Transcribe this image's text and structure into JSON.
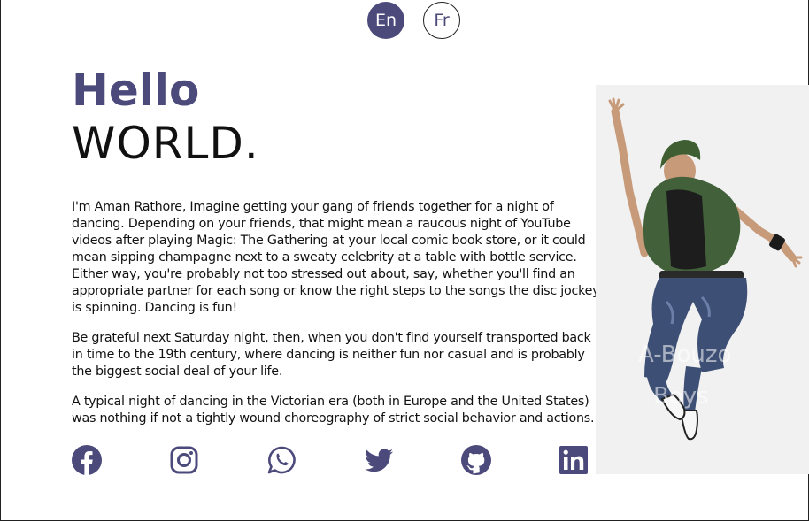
{
  "lang_switcher": {
    "en_label": "En",
    "fr_label": "Fr",
    "active": "En"
  },
  "hero": {
    "greeting": "Hello",
    "headline": "WORLD."
  },
  "bio": {
    "paragraphs": [
      "I'm Aman Rathore, Imagine getting your gang of friends together for a night of dancing. Depending on your friends, that might mean a raucous night of YouTube videos after playing Magic: The Gathering at your local comic book store, or it could mean sipping champagne next to a sweaty celebrity at a table with bottle service. Either way, you're probably not too stressed out about, say, whether you'll find an appropriate partner for each song or know the right steps to the songs the disc jockey is spinning. Dancing is fun!",
      "Be grateful next Saturday night, then, when you don't find yourself transported back in time to the 19th century, where dancing is neither fun nor casual and is probably the biggest social deal of your life.",
      "A typical night of dancing in the Victorian era (both in Europe and the United States) was nothing if not a tightly wound choreography of strict social behavior and actions."
    ]
  },
  "photo": {
    "subject": "dancer-jumping",
    "watermark": "A-Bouzo Boys"
  },
  "socials": [
    "facebook-icon",
    "instagram-icon",
    "whatsapp-icon",
    "twitter-icon",
    "github-icon",
    "linkedin-icon"
  ],
  "colors": {
    "accent": "#4b4a7a",
    "text": "#111111",
    "photo_bg": "#f1f1f1"
  }
}
